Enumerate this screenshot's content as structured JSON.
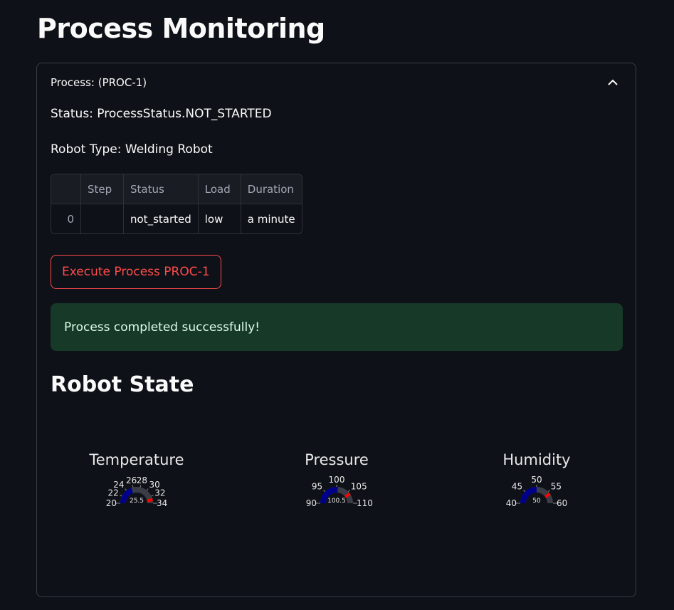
{
  "page": {
    "title": "Process Monitoring"
  },
  "process": {
    "header": "Process: (PROC-1)",
    "status_line": "Status: ProcessStatus.NOT_STARTED",
    "robot_type_line": "Robot Type: Welding Robot",
    "table": {
      "columns": [
        "",
        "Step",
        "Status",
        "Load",
        "Duration"
      ],
      "rows": [
        {
          "index": "0",
          "step": "",
          "status": "not_started",
          "load": "low",
          "duration": "a minute"
        }
      ]
    },
    "execute_button": "Execute Process PROC-1",
    "success_message": "Process completed successfully!"
  },
  "robot_state": {
    "title": "Robot State",
    "gauges": [
      {
        "title": "Temperature",
        "value": 25.5,
        "value_label": "25.5",
        "min": 20,
        "max": 34,
        "ticks": [
          "20",
          "22",
          "24",
          "26",
          "28",
          "30",
          "32",
          "34"
        ],
        "threshold": 33
      },
      {
        "title": "Pressure",
        "value": 100.5,
        "value_label": "100.5",
        "min": 90,
        "max": 110,
        "ticks": [
          "90",
          "95",
          "100",
          "105",
          "110"
        ],
        "threshold": 106
      },
      {
        "title": "Humidity",
        "value": 50,
        "value_label": "50",
        "min": 40,
        "max": 60,
        "ticks": [
          "40",
          "45",
          "50",
          "55",
          "60"
        ],
        "threshold": 56
      }
    ]
  },
  "colors": {
    "background": "#0e1117",
    "accent": "#ff4b4b",
    "success_bg": "#173928",
    "success_text": "#dffde9",
    "gauge_bar": "#00008b",
    "gauge_threshold": "#ff0000"
  }
}
